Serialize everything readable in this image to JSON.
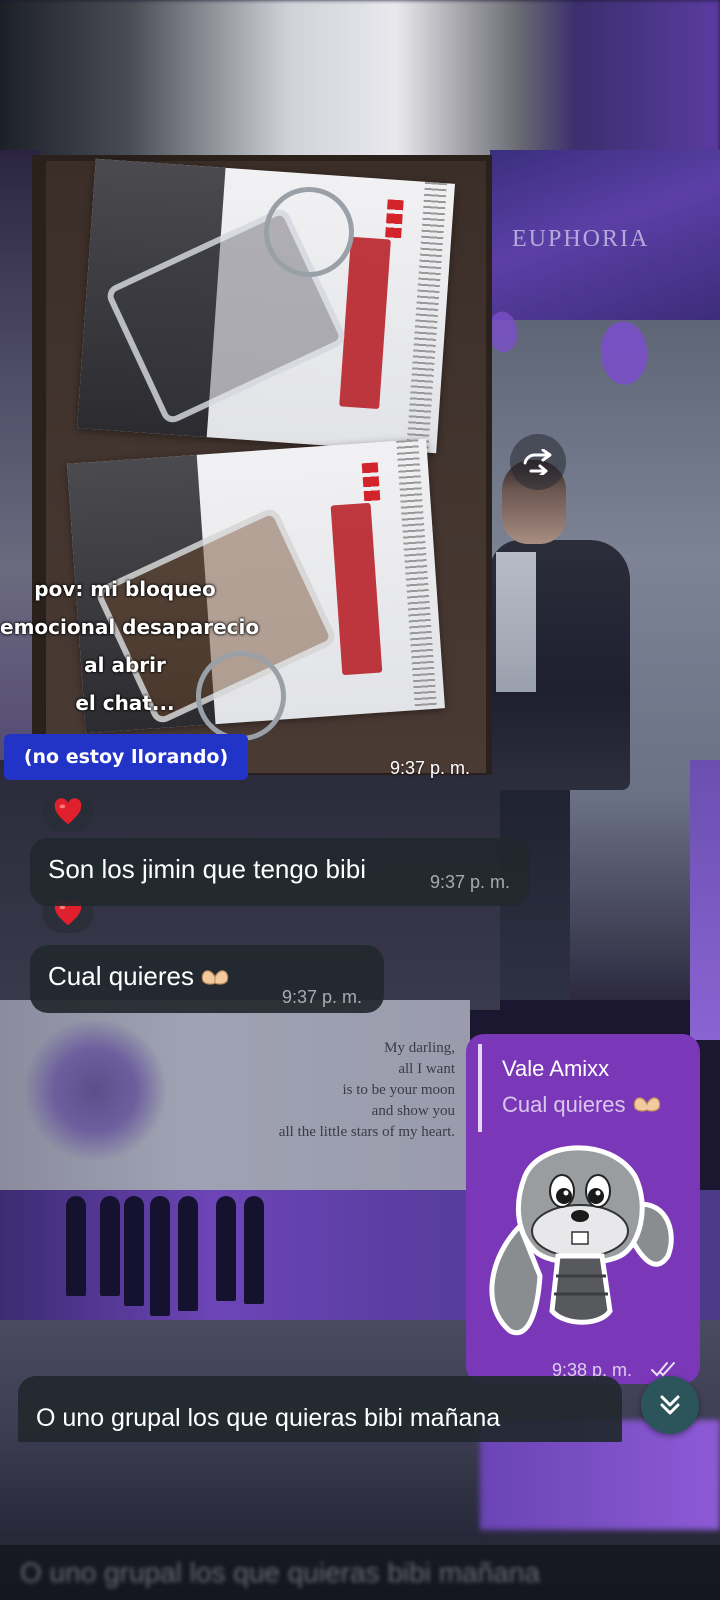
{
  "background": {
    "euphoria_text": "EUPHORIA",
    "poem_lines": [
      "My darling,",
      "all I want",
      "is to be your moon",
      "and show you",
      "all the little stars of my heart."
    ]
  },
  "photo_message": {
    "time": "9:37 p. m.",
    "forward_icon": "forward-arrow-icon"
  },
  "overlay": {
    "pov_lines": [
      "pov: mi bloqueo",
      "emocional desaparecio",
      "al abrir",
      "el chat..."
    ],
    "pill_text": "(no estoy llorando)"
  },
  "messages": [
    {
      "text": "Son los jimin que tengo bibi",
      "time": "9:37 p. m.",
      "reaction": "red-heart"
    },
    {
      "text": "Cual quieres",
      "emoji": "heart-hands",
      "time": "9:37 p. m.",
      "reaction": "red-heart"
    },
    {
      "text": "O uno grupal los que quieras bibi mañana"
    }
  ],
  "outgoing": {
    "reply_name": "Vale Amixx",
    "reply_text": "Cual quieres",
    "sticker": "sad-bunny-sticker",
    "time": "9:38 p. m.",
    "status": "read"
  },
  "colors": {
    "incoming_bubble": "#21282e",
    "outgoing_bubble": "#7a37b8",
    "pill": "#2233c8",
    "fab": "#2c555b"
  }
}
